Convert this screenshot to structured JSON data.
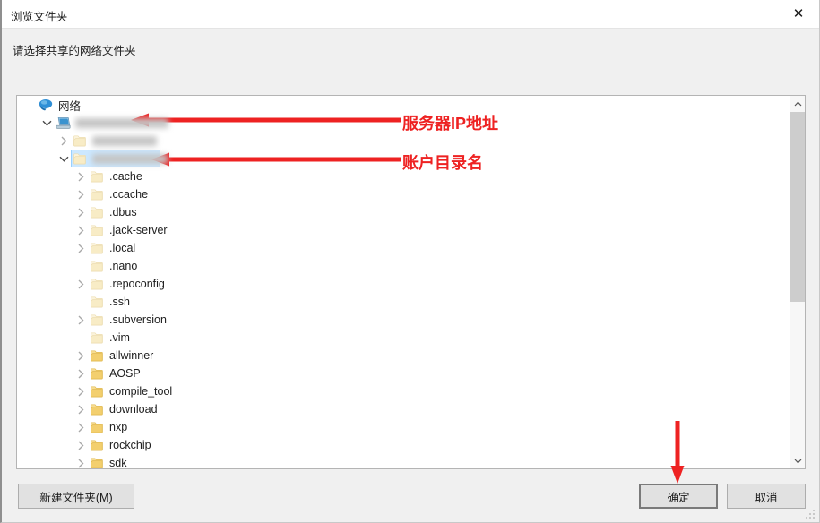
{
  "window": {
    "title": "浏览文件夹",
    "close_icon": "close-icon"
  },
  "instruction": "请选择共享的网络文件夹",
  "tree": {
    "root": {
      "label": "网络",
      "icon": "network-icon",
      "indent": 0,
      "expander": "none",
      "type": "network"
    },
    "items": [
      {
        "label": "",
        "redacted": true,
        "redact_width": "wide",
        "icon": "computer-icon",
        "indent": 1,
        "expander": "expanded",
        "type": "computer",
        "selected": false
      },
      {
        "label": "",
        "redacted": true,
        "redact_width": "mid",
        "icon": "folder-icon",
        "indent": 2,
        "expander": "collapsed",
        "type": "share",
        "selected": false
      },
      {
        "label": "",
        "redacted": true,
        "redact_width": "narrow",
        "icon": "folder-icon",
        "indent": 2,
        "expander": "expanded",
        "type": "share",
        "selected": true
      },
      {
        "label": ".cache",
        "icon": "folder-icon",
        "indent": 3,
        "expander": "collapsed",
        "type": "hidden"
      },
      {
        "label": ".ccache",
        "icon": "folder-icon",
        "indent": 3,
        "expander": "collapsed",
        "type": "hidden"
      },
      {
        "label": ".dbus",
        "icon": "folder-icon",
        "indent": 3,
        "expander": "collapsed",
        "type": "hidden"
      },
      {
        "label": ".jack-server",
        "icon": "folder-icon",
        "indent": 3,
        "expander": "collapsed",
        "type": "hidden"
      },
      {
        "label": ".local",
        "icon": "folder-icon",
        "indent": 3,
        "expander": "collapsed",
        "type": "hidden"
      },
      {
        "label": ".nano",
        "icon": "folder-icon",
        "indent": 3,
        "expander": "none",
        "type": "hidden"
      },
      {
        "label": ".repoconfig",
        "icon": "folder-icon",
        "indent": 3,
        "expander": "collapsed",
        "type": "hidden"
      },
      {
        "label": ".ssh",
        "icon": "folder-icon",
        "indent": 3,
        "expander": "none",
        "type": "hidden"
      },
      {
        "label": ".subversion",
        "icon": "folder-icon",
        "indent": 3,
        "expander": "collapsed",
        "type": "hidden"
      },
      {
        "label": ".vim",
        "icon": "folder-icon",
        "indent": 3,
        "expander": "none",
        "type": "hidden"
      },
      {
        "label": "allwinner",
        "icon": "folder-icon",
        "indent": 3,
        "expander": "collapsed",
        "type": "normal"
      },
      {
        "label": "AOSP",
        "icon": "folder-icon",
        "indent": 3,
        "expander": "collapsed",
        "type": "normal"
      },
      {
        "label": "compile_tool",
        "icon": "folder-icon",
        "indent": 3,
        "expander": "collapsed",
        "type": "normal"
      },
      {
        "label": "download",
        "icon": "folder-icon",
        "indent": 3,
        "expander": "collapsed",
        "type": "normal"
      },
      {
        "label": "nxp",
        "icon": "folder-icon",
        "indent": 3,
        "expander": "collapsed",
        "type": "normal"
      },
      {
        "label": "rockchip",
        "icon": "folder-icon",
        "indent": 3,
        "expander": "collapsed",
        "type": "normal"
      },
      {
        "label": "sdk",
        "icon": "folder-icon",
        "indent": 3,
        "expander": "collapsed",
        "type": "normal"
      }
    ]
  },
  "scrollbar": {
    "up_icon": "chevron-up-icon",
    "down_icon": "chevron-down-icon"
  },
  "buttons": {
    "new_folder": "新建文件夹(M)",
    "ok": "确定",
    "cancel": "取消"
  },
  "annotations": [
    {
      "text": "服务器IP地址",
      "kind": "arrow-left",
      "color": "#ee2222"
    },
    {
      "text": "账户目录名",
      "kind": "arrow-left",
      "color": "#ee2222"
    },
    {
      "text": "",
      "kind": "arrow-down",
      "color": "#ee2222"
    }
  ],
  "colors": {
    "annotation_red": "#ee2222",
    "selection_blue": "#cce8ff",
    "dialog_bg": "#f0f0f0",
    "panel_bg": "#ffffff",
    "folder_yellow": "#f5c842",
    "folder_pale": "#f7e6b5"
  }
}
